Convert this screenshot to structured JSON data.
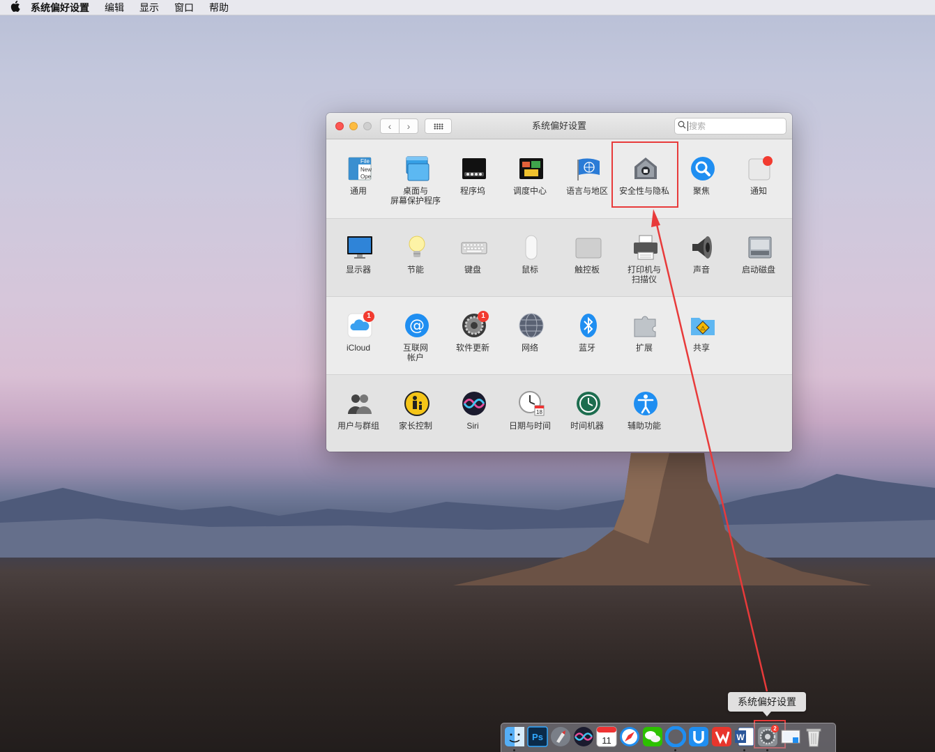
{
  "menubar": {
    "apple_icon": "apple-icon",
    "app_name": "系统偏好设置",
    "items": [
      "编辑",
      "显示",
      "窗口",
      "帮助"
    ]
  },
  "window": {
    "title": "系统偏好设置",
    "search_placeholder": "搜索",
    "sections": [
      [
        {
          "id": "general",
          "label": "通用",
          "icon": "general-icon"
        },
        {
          "id": "desktop",
          "label": "桌面与\n屏幕保护程序",
          "icon": "desktop-icon"
        },
        {
          "id": "dock",
          "label": "程序坞",
          "icon": "dock-icon"
        },
        {
          "id": "mission-control",
          "label": "调度中心",
          "icon": "mission-control-icon"
        },
        {
          "id": "language",
          "label": "语言与地区",
          "icon": "flag-icon"
        },
        {
          "id": "security",
          "label": "安全性与隐私",
          "icon": "house-lock-icon"
        },
        {
          "id": "spotlight",
          "label": "聚焦",
          "icon": "magnifier-icon"
        },
        {
          "id": "notifications",
          "label": "通知",
          "icon": "notifications-icon"
        }
      ],
      [
        {
          "id": "displays",
          "label": "显示器",
          "icon": "display-icon"
        },
        {
          "id": "energy",
          "label": "节能",
          "icon": "bulb-icon"
        },
        {
          "id": "keyboard",
          "label": "键盘",
          "icon": "keyboard-icon"
        },
        {
          "id": "mouse",
          "label": "鼠标",
          "icon": "mouse-icon"
        },
        {
          "id": "trackpad",
          "label": "触控板",
          "icon": "trackpad-icon"
        },
        {
          "id": "printers",
          "label": "打印机与\n扫描仪",
          "icon": "printer-icon"
        },
        {
          "id": "sound",
          "label": "声音",
          "icon": "speaker-icon"
        },
        {
          "id": "startup-disk",
          "label": "启动磁盘",
          "icon": "disk-icon"
        }
      ],
      [
        {
          "id": "icloud",
          "label": "iCloud",
          "icon": "icloud-icon",
          "badge": "1"
        },
        {
          "id": "internet-accounts",
          "label": "互联网\n帐户",
          "icon": "at-icon"
        },
        {
          "id": "software-update",
          "label": "软件更新",
          "icon": "gear-icon",
          "badge": "1"
        },
        {
          "id": "network",
          "label": "网络",
          "icon": "globe-icon"
        },
        {
          "id": "bluetooth",
          "label": "蓝牙",
          "icon": "bluetooth-icon"
        },
        {
          "id": "extensions",
          "label": "扩展",
          "icon": "puzzle-icon"
        },
        {
          "id": "sharing",
          "label": "共享",
          "icon": "sharing-folder-icon"
        }
      ],
      [
        {
          "id": "users",
          "label": "用户与群组",
          "icon": "users-icon"
        },
        {
          "id": "parental",
          "label": "家长控制",
          "icon": "parental-icon"
        },
        {
          "id": "siri",
          "label": "Siri",
          "icon": "siri-icon"
        },
        {
          "id": "date-time",
          "label": "日期与时间",
          "icon": "clock-icon"
        },
        {
          "id": "time-machine",
          "label": "时间机器",
          "icon": "time-machine-icon"
        },
        {
          "id": "accessibility",
          "label": "辅助功能",
          "icon": "accessibility-icon"
        }
      ]
    ]
  },
  "dock": {
    "tooltip": "系统偏好设置",
    "items": [
      {
        "name": "finder-icon",
        "running": true
      },
      {
        "name": "photoshop-icon",
        "text": "Ps",
        "running": false
      },
      {
        "name": "launchpad-icon",
        "running": false
      },
      {
        "name": "siri-icon",
        "running": false
      },
      {
        "name": "calendar-icon",
        "text": "11",
        "running": false
      },
      {
        "name": "safari-icon",
        "running": false
      },
      {
        "name": "wechat-icon",
        "running": false
      },
      {
        "name": "browser-icon",
        "running": true
      },
      {
        "name": "app-u-icon",
        "running": false
      },
      {
        "name": "wps-icon",
        "running": false
      },
      {
        "name": "word-icon",
        "text": "W",
        "running": true
      },
      {
        "name": "system-preferences-icon",
        "badge": "2",
        "running": true
      },
      {
        "name": "preview-icon",
        "running": false
      },
      {
        "name": "trash-icon",
        "running": false
      }
    ]
  },
  "colors": {
    "annotation": "#e83a3a",
    "badge": "#f23b30"
  }
}
